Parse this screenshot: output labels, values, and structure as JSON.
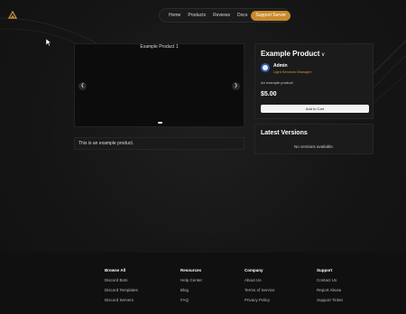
{
  "nav": {
    "items": [
      "Home",
      "Products",
      "Reviews",
      "Docs"
    ],
    "cta": "Support Server"
  },
  "media": {
    "title": "Example Product 1",
    "prev_icon": "chevron-left-icon",
    "next_icon": "chevron-right-icon"
  },
  "description": "This is an example product.",
  "product": {
    "title": "Example Product",
    "version_toggle": "v",
    "author": "Admin",
    "role": "Light Services Manager",
    "desc": "An example product",
    "price": "$5.00",
    "cart": "Add to Cart"
  },
  "versions": {
    "title": "Latest Versions",
    "empty": "No versions available."
  },
  "footer": {
    "columns": [
      {
        "head": "Browse All",
        "links": [
          "Discord Bots",
          "Discord Templates",
          "Discord Servers"
        ]
      },
      {
        "head": "Resources",
        "links": [
          "Help Center",
          "Blog",
          "FAQ"
        ]
      },
      {
        "head": "Company",
        "links": [
          "About Us",
          "Terms of Service",
          "Privacy Policy"
        ]
      },
      {
        "head": "Support",
        "links": [
          "Contact Us",
          "Report Abuse",
          "Support Ticket"
        ]
      }
    ]
  },
  "colors": {
    "accent": "#c98a2b",
    "role": "#d19a3d",
    "background": "#141414"
  }
}
